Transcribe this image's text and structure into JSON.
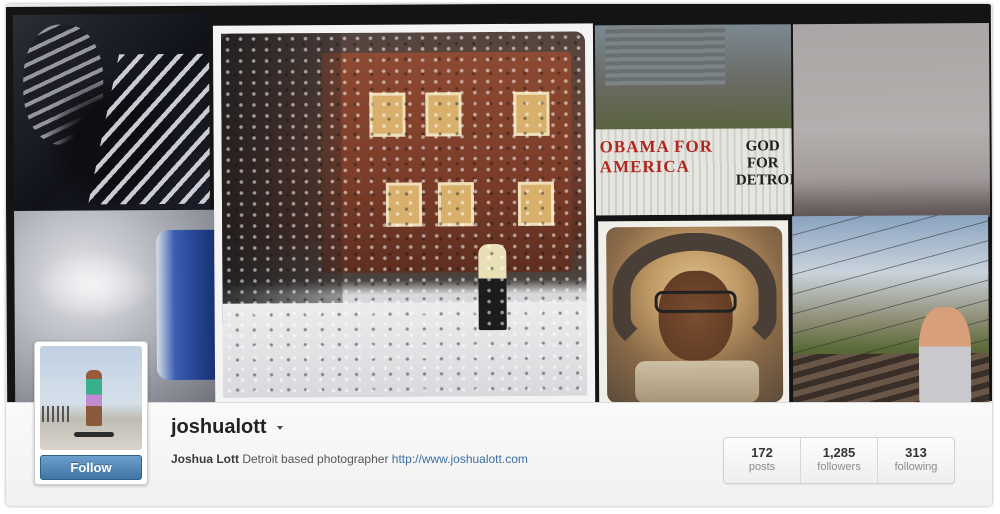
{
  "profile": {
    "username": "joshualott",
    "full_name": "Joshua Lott",
    "bio": "Detroit based photographer",
    "website": "http://www.joshualott.com",
    "follow_label": "Follow"
  },
  "stats": [
    {
      "count": "172",
      "label": "posts"
    },
    {
      "count": "1,285",
      "label": "followers"
    },
    {
      "count": "313",
      "label": "following"
    }
  ],
  "graffiti": {
    "left": "OBAMA FOR AMERICA",
    "right": "GOD FOR DETROIT"
  },
  "colors": {
    "follow_button": "#4a7eb0",
    "link": "#3a6ea5",
    "mosaic_background": "#141414"
  },
  "icons": {
    "username_dropdown": "caret-down-icon"
  }
}
